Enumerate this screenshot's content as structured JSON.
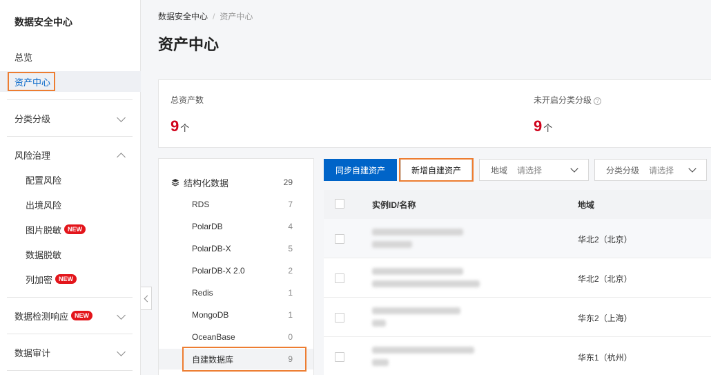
{
  "sidebar": {
    "title": "数据安全中心",
    "items": [
      {
        "label": "总览"
      },
      {
        "label": "资产中心"
      },
      {
        "label": "分类分级"
      },
      {
        "label": "风险治理"
      },
      {
        "label": "配置风险"
      },
      {
        "label": "出境风险"
      },
      {
        "label": "图片脱敏",
        "badge": "NEW"
      },
      {
        "label": "数据脱敏"
      },
      {
        "label": "列加密",
        "badge": "NEW"
      },
      {
        "label": "数据检测响应",
        "badge": "NEW"
      },
      {
        "label": "数据审计"
      }
    ]
  },
  "breadcrumb": {
    "root": "数据安全中心",
    "separator": "/",
    "current": "资产中心"
  },
  "page_title": "资产中心",
  "stats": {
    "total_label": "总资产数",
    "total_value": "9",
    "total_unit": "个",
    "unclassified_label": "未开启分类分级",
    "help_glyph": "?",
    "unclassified_value": "9",
    "unclassified_unit": "个"
  },
  "tree": {
    "root": {
      "label": "结构化数据",
      "count": "29"
    },
    "children": [
      {
        "label": "RDS",
        "count": "7"
      },
      {
        "label": "PolarDB",
        "count": "4"
      },
      {
        "label": "PolarDB-X",
        "count": "5"
      },
      {
        "label": "PolarDB-X 2.0",
        "count": "2"
      },
      {
        "label": "Redis",
        "count": "1"
      },
      {
        "label": "MongoDB",
        "count": "1"
      },
      {
        "label": "OceanBase",
        "count": "0"
      },
      {
        "label": "自建数据库",
        "count": "9"
      }
    ]
  },
  "toolbar": {
    "sync_label": "同步自建资产",
    "add_label": "新增自建资产",
    "region_filter": {
      "label": "地域",
      "placeholder": "请选择"
    },
    "class_filter": {
      "label": "分类分级",
      "placeholder": "请选择"
    }
  },
  "table": {
    "columns": [
      "实例ID/名称",
      "地域"
    ],
    "rows": [
      {
        "region": "华北2（北京）"
      },
      {
        "region": "华北2（北京）"
      },
      {
        "region": "华东2（上海）"
      },
      {
        "region": "华东1（杭州）"
      }
    ]
  },
  "colors": {
    "primary": "#0064c8",
    "highlight": "#ed7d31",
    "stat_value": "#d0021b",
    "badge": "#e3151b"
  }
}
